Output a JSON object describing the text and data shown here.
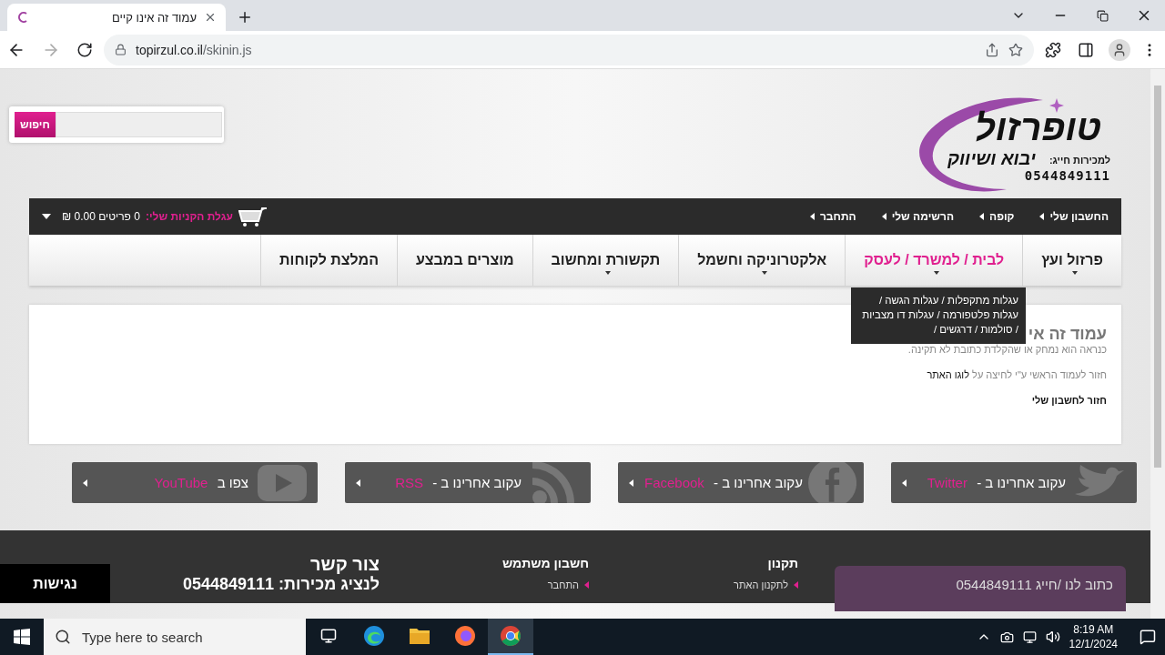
{
  "browser": {
    "tabs": [
      {
        "title": "עמוד זה אינו קיים",
        "selected": true
      }
    ],
    "address": {
      "host": "topirzul.co.il",
      "path": "/skinin.js"
    }
  },
  "header": {
    "logo": {
      "name": "טופרזול",
      "tagline": "יבוא ושיווק",
      "phone_label": "למכירות חייג:",
      "phone": "0544849111"
    },
    "search": {
      "button": "חיפוש"
    }
  },
  "top_bar": {
    "links": [
      "החשבון שלי",
      "קופה",
      "הרשימה שלי",
      "התחבר"
    ],
    "cart": {
      "label": "עגלת הקניות שלי:",
      "summary": "0 פריטים 0.00 ₪"
    }
  },
  "nav": [
    {
      "label": "פרזול ועץ",
      "has_submenu": true,
      "selected": false
    },
    {
      "label": "לבית / למשרד / לעסק",
      "has_submenu": true,
      "selected": true
    },
    {
      "label": "אלקטרוניקה וחשמל",
      "has_submenu": true,
      "selected": false
    },
    {
      "label": "תקשורת ומחשוב",
      "has_submenu": true,
      "selected": false
    },
    {
      "label": "מוצרים במבצע",
      "has_submenu": false,
      "selected": false
    },
    {
      "label": "המלצת לקוחות",
      "has_submenu": false,
      "selected": false
    }
  ],
  "tooltip": "עגלות מתקפלות / עגלות הגשה / עגלות פלטפורמה / עגלות דו מצביות / סולמות / דרגשים /",
  "content": {
    "title": "עמוד זה אי",
    "subtitle": "כנראה הוא נמחק או שהקלדת כתובת לא תקינה.",
    "back_text": "חזור לעמוד הראשי ע\"י לחיצה על",
    "back_link": "לוגו האתר",
    "account_link": "חזור לחשבון שלי"
  },
  "social": [
    {
      "lead": "עקוב אחרינו ב - ",
      "network": "Twitter",
      "kind": "bird"
    },
    {
      "lead": "עקוב אחרינו ב - ",
      "network": "Facebook",
      "kind": "f"
    },
    {
      "lead": "עקוב אחרינו ב - ",
      "network": "RSS",
      "kind": "rss"
    },
    {
      "lead": "צפו ב ",
      "network": "YouTube",
      "kind": "tv"
    }
  ],
  "footer": {
    "contact_box": "כתוב לנו /חייג 0544849111",
    "columns": [
      {
        "title": "תקנון",
        "links": [
          "לתקנון האתר"
        ]
      },
      {
        "title": "חשבון משתמש",
        "links": [
          "התחבר"
        ]
      }
    ],
    "contact": {
      "title": "צור קשר",
      "line": "לנציג מכירות: 0544849111"
    },
    "accessibility": "נגישות"
  },
  "taskbar": {
    "search_placeholder": "Type here to search",
    "apps": [
      {
        "kind": "edge",
        "selected": false
      },
      {
        "kind": "folder",
        "selected": false
      },
      {
        "kind": "firefox",
        "selected": false
      },
      {
        "kind": "chrome",
        "selected": true
      }
    ],
    "time": "8:19 AM",
    "date": "12/1/2024"
  }
}
